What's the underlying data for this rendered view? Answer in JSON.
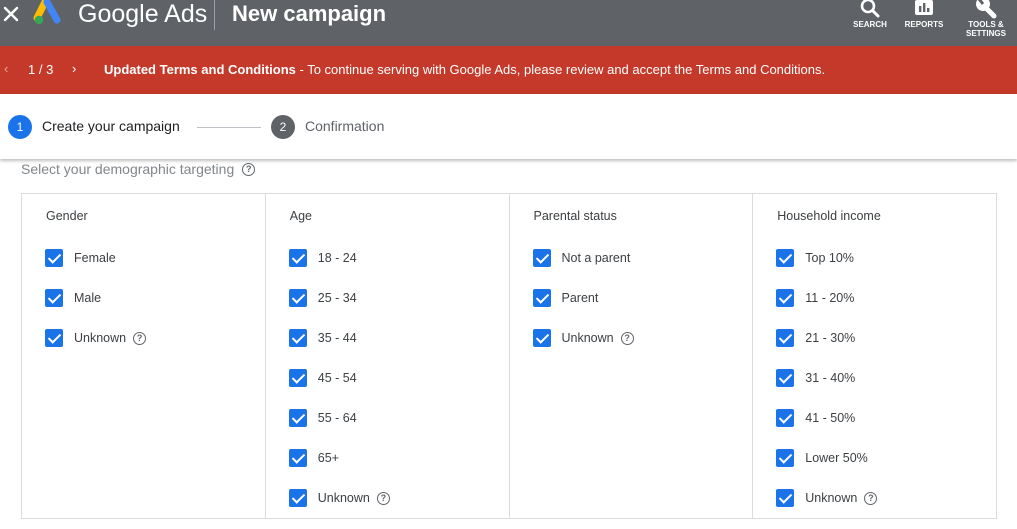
{
  "app": {
    "brand": "Google Ads",
    "title": "New campaign"
  },
  "toolbar": {
    "search_label": "SEARCH",
    "reports_label": "REPORTS",
    "tools_label_line1": "TOOLS &",
    "tools_label_line2": "SETTINGS"
  },
  "banner": {
    "page": "1 / 3",
    "heading": "Updated Terms and Conditions",
    "message": " - To continue serving with Google Ads, please review and accept the Terms and Conditions.",
    "color": "#c5392a"
  },
  "stepper": {
    "steps": [
      {
        "number": "1",
        "label": "Create your campaign",
        "active": true
      },
      {
        "number": "2",
        "label": "Confirmation",
        "active": false
      }
    ]
  },
  "targeting": {
    "subtitle": "Select your demographic targeting",
    "help_glyph": "?",
    "columns": [
      {
        "title": "Gender",
        "options": [
          {
            "label": "Female",
            "checked": true
          },
          {
            "label": "Male",
            "checked": true
          },
          {
            "label": "Unknown",
            "checked": true,
            "help": true
          }
        ]
      },
      {
        "title": "Age",
        "options": [
          {
            "label": "18 - 24",
            "checked": true
          },
          {
            "label": "25 - 34",
            "checked": true
          },
          {
            "label": "35 - 44",
            "checked": true
          },
          {
            "label": "45 - 54",
            "checked": true
          },
          {
            "label": "55 - 64",
            "checked": true
          },
          {
            "label": "65+",
            "checked": true
          },
          {
            "label": "Unknown",
            "checked": true,
            "help": true
          }
        ]
      },
      {
        "title": "Parental status",
        "options": [
          {
            "label": "Not a parent",
            "checked": true
          },
          {
            "label": "Parent",
            "checked": true
          },
          {
            "label": "Unknown",
            "checked": true,
            "help": true
          }
        ]
      },
      {
        "title": "Household income",
        "options": [
          {
            "label": "Top 10%",
            "checked": true
          },
          {
            "label": "11 - 20%",
            "checked": true
          },
          {
            "label": "21 - 30%",
            "checked": true
          },
          {
            "label": "31 - 40%",
            "checked": true
          },
          {
            "label": "41 - 50%",
            "checked": true
          },
          {
            "label": "Lower 50%",
            "checked": true
          },
          {
            "label": "Unknown",
            "checked": true,
            "help": true
          }
        ]
      }
    ]
  },
  "colors": {
    "topbar": "#5f6368",
    "accent": "#1a73e8"
  }
}
